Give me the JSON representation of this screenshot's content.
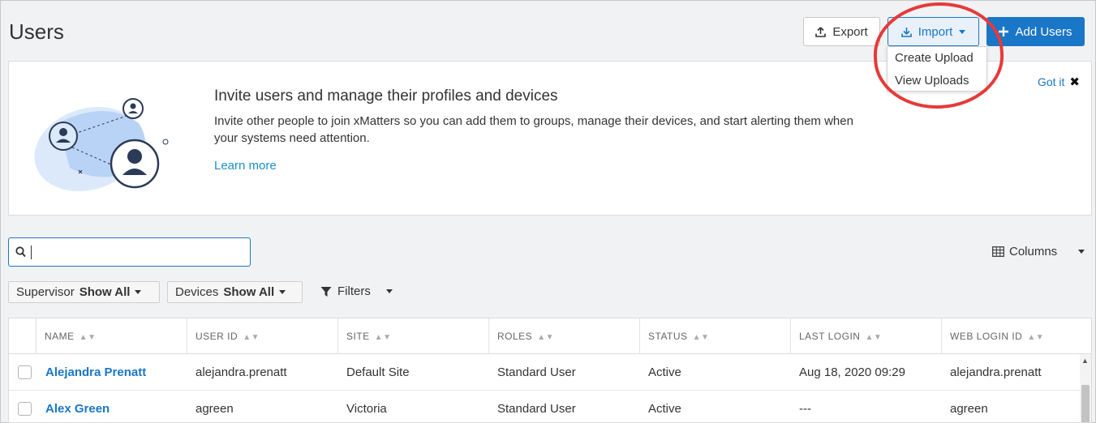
{
  "page": {
    "title": "Users"
  },
  "toolbar": {
    "export_label": "Export",
    "import_label": "Import",
    "add_label": "Add Users"
  },
  "import_menu": {
    "items": [
      "Create Upload",
      "View Uploads"
    ]
  },
  "banner": {
    "title": "Invite users and manage their profiles and devices",
    "text": "Invite other people to join xMatters so you can add them to groups, manage their devices, and start alerting them when your systems need attention.",
    "link": "Learn more",
    "dismiss": "Got it"
  },
  "search": {
    "value": "",
    "placeholder": ""
  },
  "columns_button": "Columns",
  "filters": {
    "supervisor": {
      "label": "Supervisor",
      "value": "Show All"
    },
    "devices": {
      "label": "Devices",
      "value": "Show All"
    },
    "filters_label": "Filters"
  },
  "table": {
    "headers": [
      "NAME",
      "USER ID",
      "SITE",
      "ROLES",
      "STATUS",
      "LAST LOGIN",
      "WEB LOGIN ID"
    ],
    "rows": [
      [
        "Alejandra Prenatt",
        "alejandra.prenatt",
        "Default Site",
        "Standard User",
        "Active",
        "Aug 18, 2020 09:29",
        "alejandra.prenatt"
      ],
      [
        "Alex Green",
        "agreen",
        "Victoria",
        "Standard User",
        "Active",
        "---",
        "agreen"
      ]
    ]
  },
  "colors": {
    "accent": "#1a76c7",
    "link": "#1a8fc4",
    "highlight": "#e53a3a",
    "background": "#f1f2f4"
  },
  "icons": {
    "export": "upload-icon",
    "import": "download-icon",
    "add": "plus-icon",
    "search": "search-icon",
    "columns": "grid-icon",
    "filters": "funnel-icon",
    "dismiss": "close-icon"
  }
}
